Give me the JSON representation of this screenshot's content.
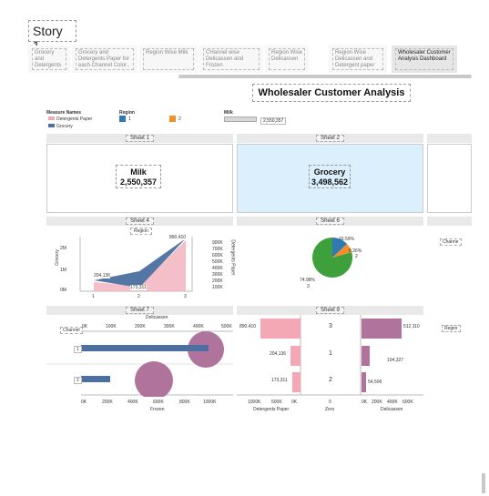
{
  "story": {
    "title": "Story 1",
    "tabs": [
      {
        "label": "Grocery and Detergents Paper for ea...",
        "active": false
      },
      {
        "label": "Grocery and Detergents Paper for each Channel  Color..",
        "active": false
      },
      {
        "label": "Region Wise Milk",
        "active": false
      },
      {
        "label": "CHannel wise Delicassen and Frozen",
        "active": false
      },
      {
        "label": "Region Wise Delicassen",
        "active": false
      },
      {
        "label": "Region Wise Delicassen and Detergent paper",
        "active": false
      },
      {
        "label": "Wholesaler Customer Analysis Dashboard",
        "active": true
      }
    ]
  },
  "dashboard": {
    "title": "Wholesaler Customer Analysis",
    "legend": {
      "measure_names_title": "Measure Names",
      "measure_items": [
        {
          "label": "Detergents Paper",
          "color": "#f4a7b5"
        },
        {
          "label": "Grocery",
          "color": "#4a6fa0"
        }
      ],
      "region_title": "Region",
      "region_items": [
        {
          "label": "1",
          "color": "#2f79b5"
        },
        {
          "label": "2",
          "color": "#f28e2b"
        }
      ],
      "milk_title": "Milk",
      "milk_value": "2,550,357"
    },
    "sheets": {
      "s1": "Sheet 1",
      "s2": "Sheet 2",
      "s4": "Sheet 4",
      "s6": "Sheet 6",
      "s7": "Sheet 7",
      "s9": "Sheet 9"
    },
    "kpis": {
      "milk_label": "Milk",
      "milk_value": "2,550,357",
      "grocery_label": "Grocery",
      "grocery_value": "3,498,562"
    },
    "sheet4": {
      "header": "Region",
      "y_left_label": "Grocery",
      "y_right_label": "Detergents Paper",
      "left_ticks": [
        "2M",
        "1M",
        "0M"
      ],
      "right_ticks": [
        "900K",
        "700K",
        "600K",
        "500K",
        "400K",
        "300K",
        "200K",
        "100K"
      ],
      "x_ticks": [
        "1",
        "2",
        "3"
      ],
      "labels": [
        "890,410",
        "204,136",
        "173,311"
      ]
    },
    "sheet6": {
      "labels": [
        "16.59%",
        "8.36%",
        "2",
        "74.98%",
        "3"
      ],
      "right_label": "Channe"
    },
    "sheet7": {
      "top_axis_title": "Delicassen",
      "channel_label": "Channel",
      "top_ticks": [
        "0K",
        "100K",
        "200K",
        "300K",
        "400K",
        "500K"
      ],
      "rows": [
        "1",
        "2"
      ],
      "bottom_ticks": [
        "0K",
        "200K",
        "400K",
        "600K",
        "800K",
        "1000K"
      ],
      "bottom_axis_title": "Frozen"
    },
    "sheet9": {
      "bars_left_labels": [
        "890,410",
        "204,136",
        "173,311"
      ],
      "center_labels": [
        "3",
        "1",
        "2"
      ],
      "bars_right_labels": [
        "512,110",
        "104,327",
        "54,506"
      ],
      "left_ticks": [
        "1000K",
        "500K",
        "0K"
      ],
      "center_tick": "0",
      "right_ticks": [
        "0K",
        "200K",
        "400K",
        "600K"
      ],
      "left_axis_title": "Detergents Paper",
      "center_axis_title": "Zero",
      "right_axis_title": "Delicassen",
      "right_label": "Regior"
    }
  }
}
